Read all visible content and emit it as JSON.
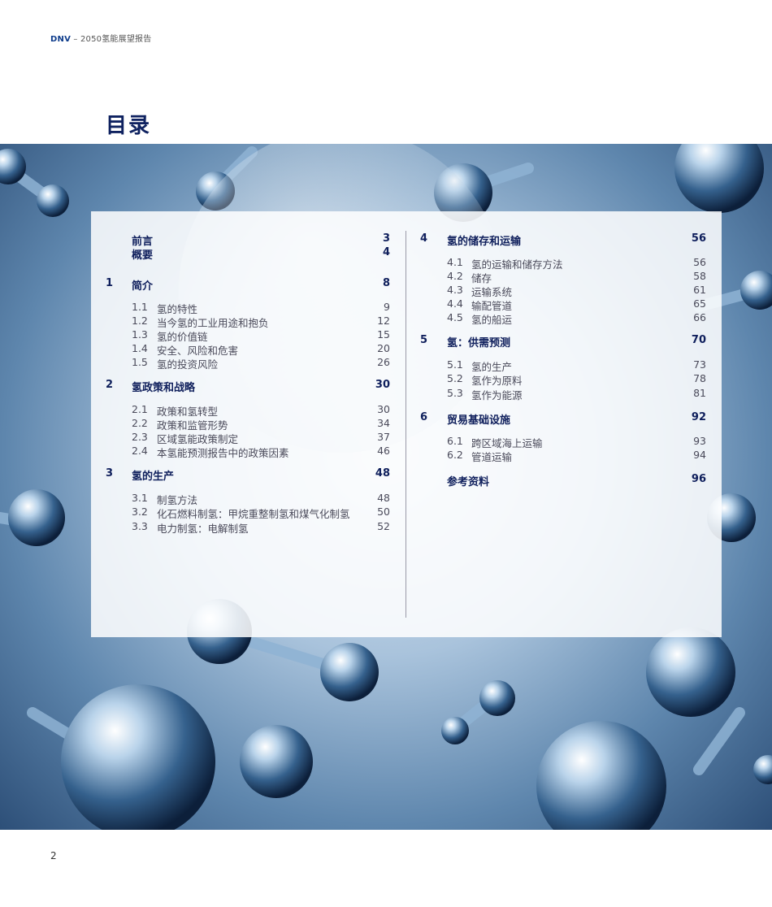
{
  "header": {
    "brand": "DNV",
    "subtitle": "– 2050氢能展望报告"
  },
  "page_title": "目录",
  "toc_left": [
    {
      "num": "",
      "label": "前言",
      "page": "3",
      "subs": []
    },
    {
      "num": "",
      "label": "概要",
      "page": "4",
      "subs": []
    },
    {
      "num": "1",
      "label": "简介",
      "page": "8",
      "subs": [
        {
          "num": "1.1",
          "label": "氢的特性",
          "page": "9"
        },
        {
          "num": "1.2",
          "label": "当今氢的工业用途和抱负",
          "page": "12"
        },
        {
          "num": "1.3",
          "label": "氢的价值链",
          "page": "15"
        },
        {
          "num": "1.4",
          "label": "安全、风险和危害",
          "page": "20"
        },
        {
          "num": "1.5",
          "label": "氢的投资风险",
          "page": "26"
        }
      ]
    },
    {
      "num": "2",
      "label": "氢政策和战略",
      "page": "30",
      "subs": [
        {
          "num": "2.1",
          "label": "政策和氢转型",
          "page": "30"
        },
        {
          "num": "2.2",
          "label": "政策和监管形势",
          "page": "34"
        },
        {
          "num": "2.3",
          "label": "区域氢能政策制定",
          "page": "37"
        },
        {
          "num": "2.4",
          "label": "本氢能预测报告中的政策因素",
          "page": "46"
        }
      ]
    },
    {
      "num": "3",
      "label": "氢的生产",
      "page": "48",
      "subs": [
        {
          "num": "3.1",
          "label": "制氢方法",
          "page": "48"
        },
        {
          "num": "3.2",
          "label": "化石燃料制氢：甲烷重整制氢和煤气化制氢",
          "page": "50"
        },
        {
          "num": "3.3",
          "label": "电力制氢：电解制氢",
          "page": "52"
        }
      ]
    }
  ],
  "toc_right": [
    {
      "num": "4",
      "label": "氢的储存和运输",
      "page": "56",
      "subs": [
        {
          "num": "4.1",
          "label": "氢的运输和储存方法",
          "page": "56"
        },
        {
          "num": "4.2",
          "label": "储存",
          "page": "58"
        },
        {
          "num": "4.3",
          "label": "运输系统",
          "page": "61"
        },
        {
          "num": "4.4",
          "label": "输配管道",
          "page": "65"
        },
        {
          "num": "4.5",
          "label": "氢的船运",
          "page": "66"
        }
      ]
    },
    {
      "num": "5",
      "label": "氢：供需预测",
      "page": "70",
      "subs": [
        {
          "num": "5.1",
          "label": "氢的生产",
          "page": "73"
        },
        {
          "num": "5.2",
          "label": "氢作为原料",
          "page": "78"
        },
        {
          "num": "5.3",
          "label": "氢作为能源",
          "page": "81"
        }
      ]
    },
    {
      "num": "6",
      "label": "贸易基础设施",
      "page": "92",
      "subs": [
        {
          "num": "6.1",
          "label": "跨区域海上运输",
          "page": "93"
        },
        {
          "num": "6.2",
          "label": "管道运输",
          "page": "94"
        }
      ]
    },
    {
      "num": "",
      "label": "参考资料",
      "page": "96",
      "subs": []
    }
  ],
  "page_number": "2"
}
